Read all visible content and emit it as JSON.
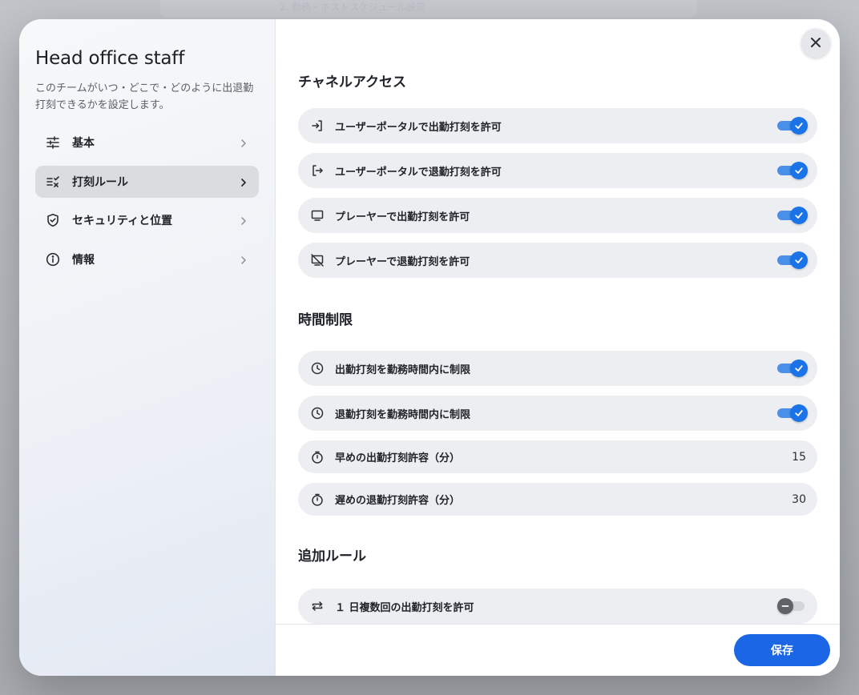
{
  "background": {
    "ghost_text": "2. 勤務・ホストスケジュール設定"
  },
  "sidebar": {
    "title": "Head office staff",
    "description": "このチームがいつ・どこで・どのように出退勤打刻できるかを設定します。",
    "items": [
      {
        "label": "基本",
        "icon": "sliders-icon",
        "active": false
      },
      {
        "label": "打刻ルール",
        "icon": "checklist-icon",
        "active": true
      },
      {
        "label": "セキュリティと位置",
        "icon": "shield-check-icon",
        "active": false
      },
      {
        "label": "情報",
        "icon": "info-icon",
        "active": false
      }
    ]
  },
  "main": {
    "sections": {
      "channel": {
        "title": "チャネルアクセス",
        "rows": [
          {
            "label": "ユーザーポータルで出勤打刻を許可",
            "icon": "login-icon",
            "enabled": true
          },
          {
            "label": "ユーザーポータルで退勤打刻を許可",
            "icon": "logout-icon",
            "enabled": true
          },
          {
            "label": "プレーヤーで出勤打刻を許可",
            "icon": "monitor-icon",
            "enabled": true
          },
          {
            "label": "プレーヤーで退勤打刻を許可",
            "icon": "monitor-off-icon",
            "enabled": true
          }
        ]
      },
      "time": {
        "title": "時間制限",
        "rows": [
          {
            "label": "出勤打刻を勤務時間内に制限",
            "icon": "clock-icon",
            "enabled": true
          },
          {
            "label": "退勤打刻を勤務時間内に制限",
            "icon": "clock-icon",
            "enabled": true
          },
          {
            "label": "早めの出勤打刻許容（分）",
            "icon": "timer-icon",
            "value": "15"
          },
          {
            "label": "遅めの退勤打刻許容（分）",
            "icon": "timer-icon",
            "value": "30"
          }
        ]
      },
      "extra": {
        "title": "追加ルール",
        "rows": [
          {
            "label": "１ 日複数回の出勤打刻を許可",
            "icon": "repeat-icon",
            "enabled": false
          }
        ]
      }
    }
  },
  "footer": {
    "save_label": "保存"
  },
  "colors": {
    "accent": "#1a66e5",
    "toggle_on": "#1a73e8",
    "row_bg": "#eceef1"
  }
}
